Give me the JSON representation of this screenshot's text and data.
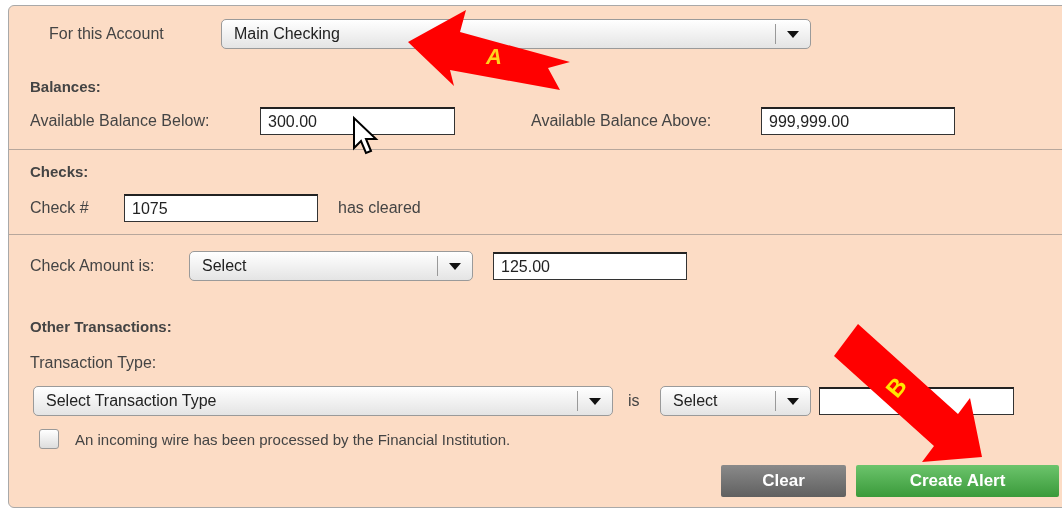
{
  "account": {
    "label": "For this Account",
    "value": "Main Checking"
  },
  "balances": {
    "heading": "Balances:",
    "below_label": "Available Balance Below:",
    "below_value": "300.00",
    "above_label": "Available Balance Above:",
    "above_value": "999,999.00"
  },
  "checks": {
    "heading": "Checks:",
    "check_label": "Check #",
    "check_value": "1075",
    "cleared_text": "has cleared",
    "amount_label": "Check Amount is:",
    "amount_select": "Select",
    "amount_value": "125.00"
  },
  "other": {
    "heading": "Other Transactions:",
    "type_label": "Transaction Type:",
    "type_select": "Select Transaction Type",
    "is_text": "is",
    "op_select": "Select",
    "wire_label": "An incoming wire has been processed by the Financial Institution.",
    "wire_checked": false
  },
  "buttons": [
    {
      "label": "Clear",
      "kind": "secondary"
    },
    {
      "label": "Create Alert",
      "kind": "primary"
    }
  ],
  "annotations": [
    {
      "label": "A",
      "kind": "left"
    },
    {
      "label": "B",
      "kind": "down-right"
    }
  ]
}
